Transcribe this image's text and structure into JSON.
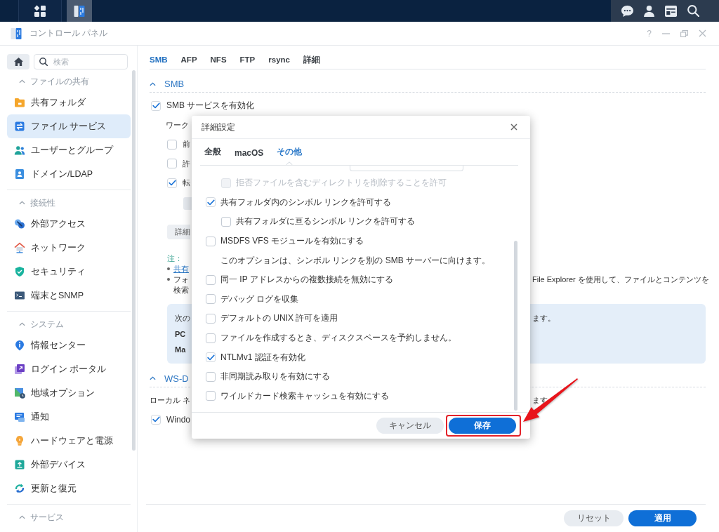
{
  "taskbar": {
    "buttons": [
      {
        "kind": "main-menu",
        "selected": false
      },
      {
        "kind": "control-panel",
        "selected": true
      }
    ],
    "tray": [
      {
        "kind": "chat"
      },
      {
        "kind": "user"
      },
      {
        "kind": "widgets"
      },
      {
        "kind": "search"
      }
    ]
  },
  "window": {
    "title": "コントロール パネル",
    "help": "?"
  },
  "sidebar": {
    "search": {
      "placeholder": "検索"
    },
    "sections": [
      {
        "title": "ファイルの共有",
        "expanded": true,
        "items": [
          {
            "label": "共有フォルダ",
            "kind": "shared-folder",
            "selected": false
          },
          {
            "label": "ファイル サービス",
            "kind": "file-services",
            "selected": true
          },
          {
            "label": "ユーザーとグループ",
            "kind": "users",
            "selected": false
          },
          {
            "label": "ドメイン/LDAP",
            "kind": "domain",
            "selected": false
          }
        ]
      },
      {
        "title": "接続性",
        "expanded": true,
        "items": [
          {
            "label": "外部アクセス",
            "kind": "external-access",
            "selected": false
          },
          {
            "label": "ネットワーク",
            "kind": "network",
            "selected": false
          },
          {
            "label": "セキュリティ",
            "kind": "security",
            "selected": false
          },
          {
            "label": "端末とSNMP",
            "kind": "terminal",
            "selected": false
          }
        ]
      },
      {
        "title": "システム",
        "expanded": true,
        "items": [
          {
            "label": "情報センター",
            "kind": "info-center",
            "selected": false
          },
          {
            "label": "ログイン ポータル",
            "kind": "login-portal",
            "selected": false
          },
          {
            "label": "地域オプション",
            "kind": "regional-options",
            "selected": false
          },
          {
            "label": "通知",
            "kind": "notification",
            "selected": false
          },
          {
            "label": "ハードウェアと電源",
            "kind": "hardware-power",
            "selected": false
          },
          {
            "label": "外部デバイス",
            "kind": "external-devices",
            "selected": false
          },
          {
            "label": "更新と復元",
            "kind": "update-restore",
            "selected": false
          }
        ]
      },
      {
        "title": "サービス",
        "expanded": true
      }
    ]
  },
  "main": {
    "tabs": [
      {
        "label": "SMB",
        "selected": true
      },
      {
        "label": "AFP",
        "selected": false
      },
      {
        "label": "NFS",
        "selected": false
      },
      {
        "label": "FTP",
        "selected": false
      },
      {
        "label": "rsync",
        "selected": false
      },
      {
        "label": "詳細",
        "selected": false
      }
    ],
    "sections": [
      {
        "title": "SMB",
        "expanded": true,
        "rows": [
          {
            "kind": "checkbox",
            "label": "SMB サービスを有効化",
            "checked": true,
            "children": [
              {
                "kind": "text",
                "text": "ワーク"
              },
              {
                "kind": "checkbox",
                "label": "前",
                "checked": false
              },
              {
                "kind": "checkbox",
                "label": "許",
                "checked": false
              },
              {
                "kind": "checkbox",
                "label": "転",
                "checked": true,
                "children": [
                  {
                    "kind": "field"
                  }
                ]
              },
              {
                "kind": "button",
                "label": "詳細"
              },
              {
                "kind": "note",
                "title": "注：",
                "bullets": [
                  {
                    "lines": [
                      {
                        "text": "共有",
                        "link": true
                      }
                    ]
                  },
                  {
                    "lines": [
                      {
                        "text": "フォ",
                        "link": false,
                        "right_part": "File Explorer を使用して、ファイルとコンテンツを"
                      },
                      {
                        "text": "検索",
                        "link": false
                      }
                    ]
                  }
                ]
              },
              {
                "kind": "info",
                "lines": [
                  {
                    "text": "次の",
                    "bold": false,
                    "right_part": "ます。"
                  },
                  {
                    "text": "PC",
                    "bold": true
                  },
                  {
                    "text": "Ma",
                    "bold": true
                  }
                ]
              }
            ]
          }
        ]
      },
      {
        "title": "WS-D",
        "expanded": true,
        "rows": [
          {
            "kind": "text",
            "text": "ローカル ネ",
            "right_part": "ます"
          },
          {
            "kind": "checkbox",
            "label": "Windo",
            "checked": true
          }
        ]
      }
    ],
    "buttons": [
      {
        "label": "リセット",
        "kind": "secondary"
      },
      {
        "label": "適用",
        "kind": "primary"
      }
    ]
  },
  "dialog": {
    "title": "詳細設定",
    "tabs": [
      {
        "label": "全般",
        "selected": false
      },
      {
        "label": "macOS",
        "selected": false
      },
      {
        "label": "その他",
        "selected": true
      }
    ],
    "options": [
      {
        "kind": "field",
        "children": [
          {
            "kind": "checkbox",
            "label": "拒否ファイルを含むディレクトリを削除することを許可",
            "checked": false,
            "disabled": true
          }
        ]
      },
      {
        "kind": "checkbox",
        "label": "共有フォルダ内のシンボル リンクを許可する",
        "checked": true,
        "disabled": false,
        "children": [
          {
            "kind": "checkbox",
            "label": "共有フォルダに亘るシンボル リンクを許可する",
            "checked": false,
            "disabled": false
          }
        ]
      },
      {
        "kind": "checkbox",
        "label": "MSDFS VFS モジュールを有効にする",
        "checked": false,
        "disabled": false,
        "hint": "このオプションは、シンボル リンクを別の SMB サーバーに向けます。"
      },
      {
        "kind": "checkbox",
        "label": "同一 IP アドレスからの複数接続を無効にする",
        "checked": false,
        "disabled": false
      },
      {
        "kind": "checkbox",
        "label": "デバッグ ログを収集",
        "checked": false,
        "disabled": false
      },
      {
        "kind": "checkbox",
        "label": "デフォルトの UNIX 許可を適用",
        "checked": false,
        "disabled": false
      },
      {
        "kind": "checkbox",
        "label": "ファイルを作成するとき、ディスクスペースを予約しません。",
        "checked": false,
        "disabled": false
      },
      {
        "kind": "checkbox",
        "label": "NTLMv1 認証を有効化",
        "checked": true,
        "disabled": false
      },
      {
        "kind": "checkbox",
        "label": "非同期読み取りを有効にする",
        "checked": false,
        "disabled": false
      },
      {
        "kind": "checkbox",
        "label": "ワイルドカード検索キャッシュを有効にする",
        "checked": false,
        "disabled": false
      }
    ],
    "buttons": [
      {
        "label": "キャンセル",
        "kind": "secondary",
        "highlighted": false
      },
      {
        "label": "保存",
        "kind": "primary",
        "highlighted": true
      }
    ]
  },
  "annotations": [
    {
      "kind": "arrow"
    }
  ]
}
